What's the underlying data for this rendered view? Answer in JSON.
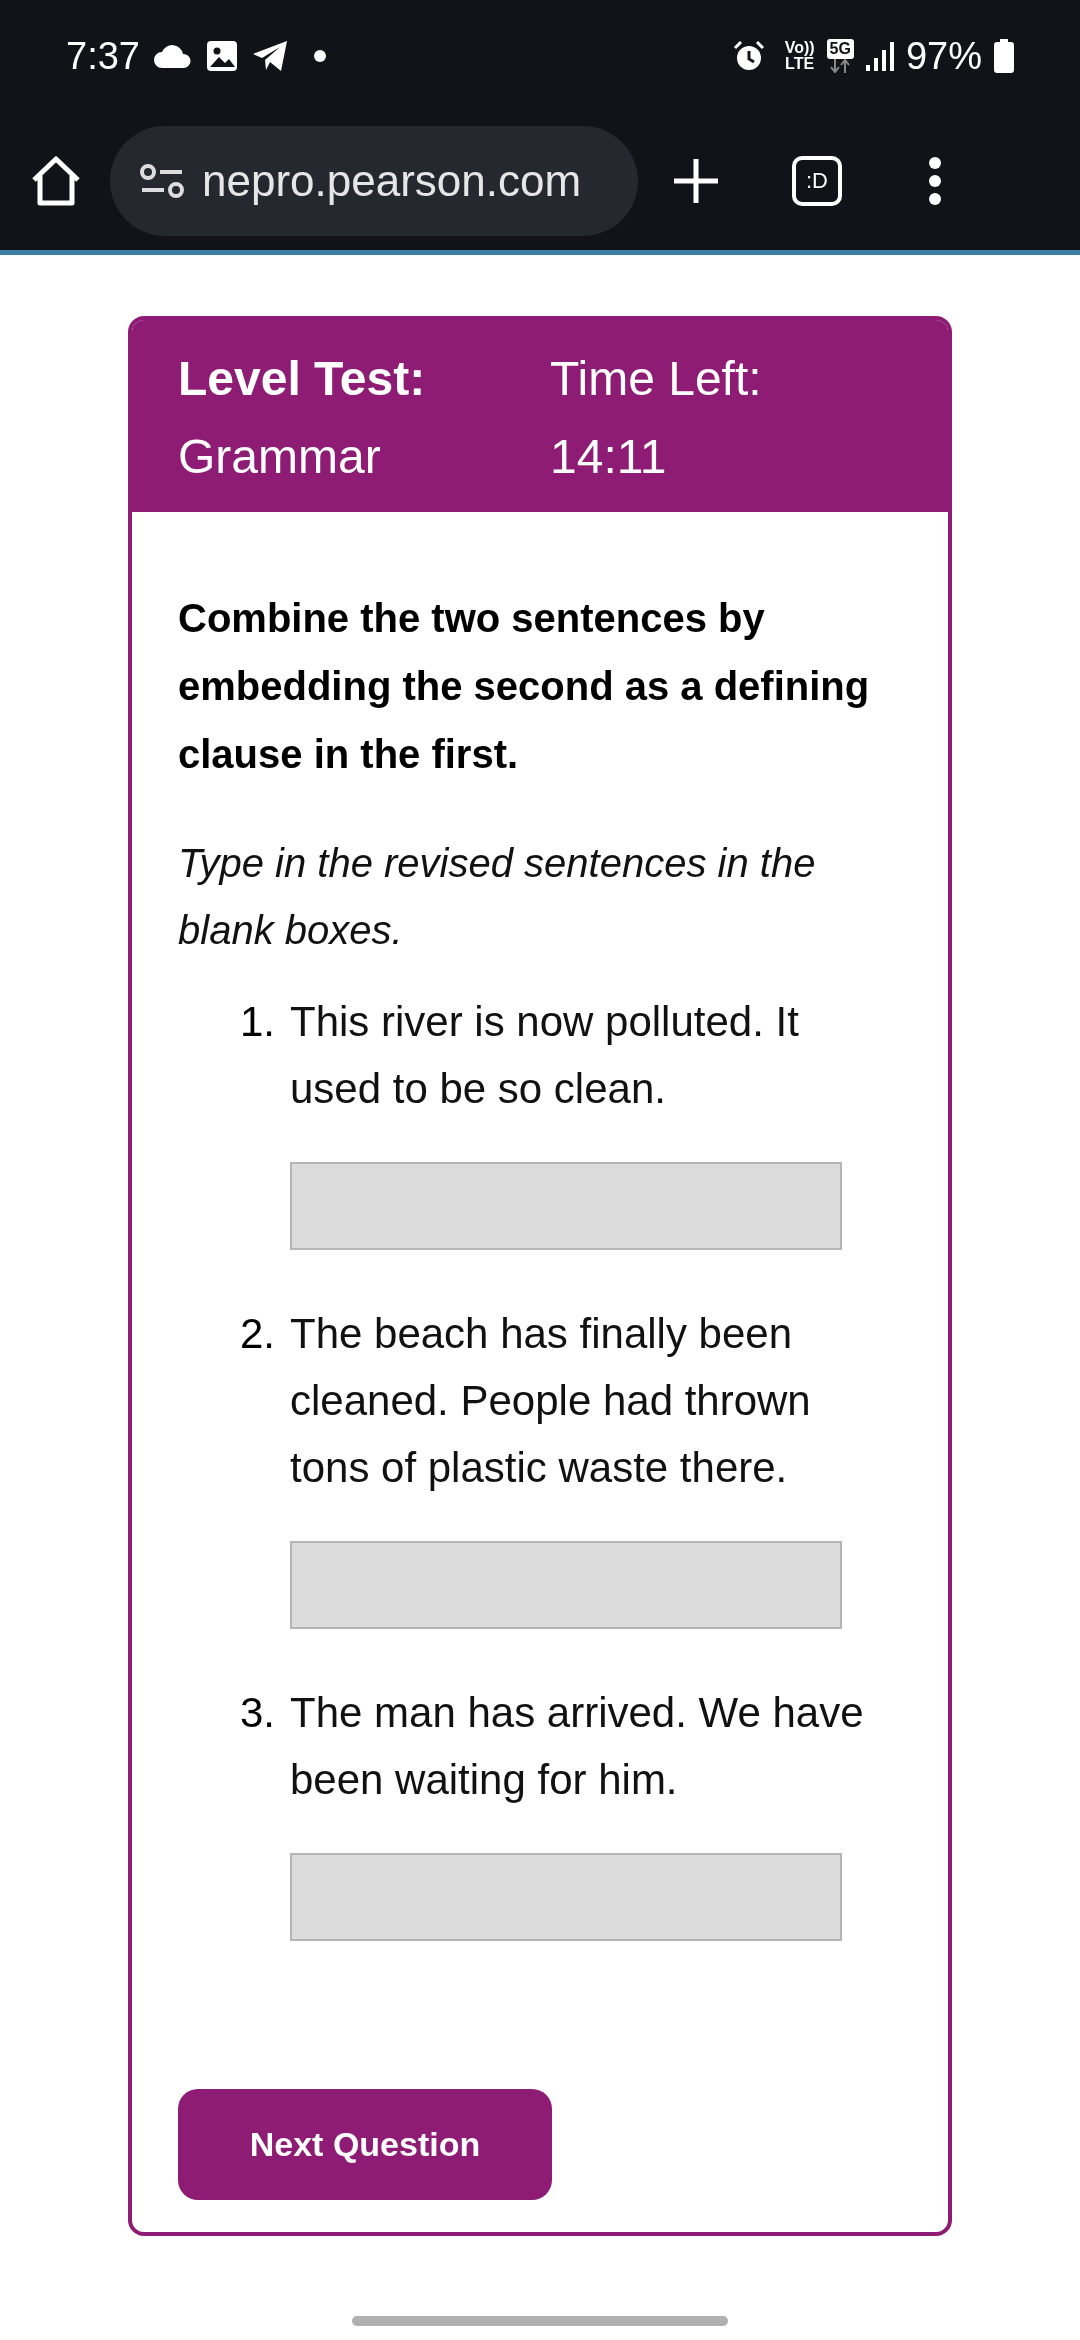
{
  "status_bar": {
    "time": "7:37",
    "volte_top": "Vo))",
    "volte_bottom": "LTE",
    "network": "5G",
    "battery": "97%"
  },
  "browser": {
    "url": "nepro.pearson.com",
    "tab_switcher": ":D"
  },
  "header": {
    "title": "Level Test:",
    "subtitle": "Grammar",
    "timer_label": "Time Left:",
    "timer": "14:11"
  },
  "instruction": "Combine the two sentences by embedding the second as a defining clause in the first.",
  "hint": "Type in the revised sentences in the blank boxes.",
  "questions": [
    {
      "number": "1.",
      "text": "This river is now polluted. It used to be so clean."
    },
    {
      "number": "2.",
      "text": "The beach has finally been cleaned. People had thrown tons of plastic waste there."
    },
    {
      "number": "3.",
      "text": "The man has arrived. We have been waiting for him."
    }
  ],
  "button": "Next Question"
}
